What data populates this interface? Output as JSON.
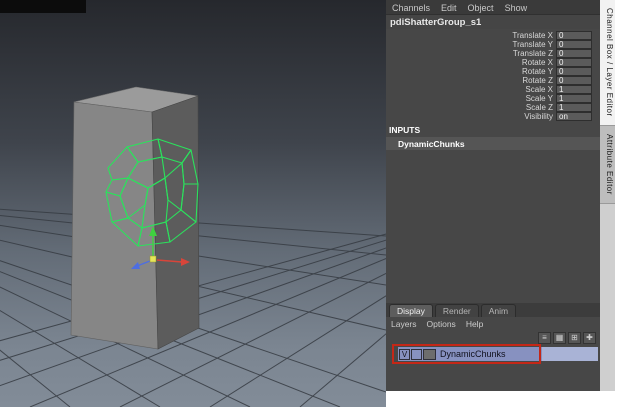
{
  "colors": {
    "wireframe_green": "#2be25c",
    "selection_lavender": "#8791c0",
    "annotation_red": "#c42717",
    "axis_x_red": "#d8453a",
    "axis_y_green": "#3fd23f",
    "axis_z_blue": "#4d6ee3"
  },
  "channel_box": {
    "menu": [
      "Channels",
      "Edit",
      "Object",
      "Show"
    ],
    "node_name": "pdiShatterGroup_s1",
    "attributes": [
      {
        "label": "Translate X",
        "value": "0"
      },
      {
        "label": "Translate Y",
        "value": "0"
      },
      {
        "label": "Translate Z",
        "value": "0"
      },
      {
        "label": "Rotate X",
        "value": "0"
      },
      {
        "label": "Rotate Y",
        "value": "0"
      },
      {
        "label": "Rotate Z",
        "value": "0"
      },
      {
        "label": "Scale X",
        "value": "1"
      },
      {
        "label": "Scale Y",
        "value": "1"
      },
      {
        "label": "Scale Z",
        "value": "1"
      },
      {
        "label": "Visibility",
        "value": "on"
      }
    ],
    "inputs_header": "INPUTS",
    "input_node": "DynamicChunks"
  },
  "layer_editor": {
    "tabs": [
      "Display",
      "Render",
      "Anim"
    ],
    "active_tab": "Display",
    "menu": [
      "Layers",
      "Options",
      "Help"
    ],
    "icons": [
      {
        "name": "layer-list-icon",
        "glyph": "≡"
      },
      {
        "name": "new-empty-layer-icon",
        "glyph": "▦"
      },
      {
        "name": "new-layer-icon",
        "glyph": "⊞"
      },
      {
        "name": "new-layer-from-selected-icon",
        "glyph": "✚"
      }
    ],
    "layer": {
      "visibility": "V",
      "name": "DynamicChunks"
    }
  },
  "side_tabs": [
    {
      "label": "Channel Box / Layer Editor"
    },
    {
      "label": "Attribute Editor"
    }
  ]
}
